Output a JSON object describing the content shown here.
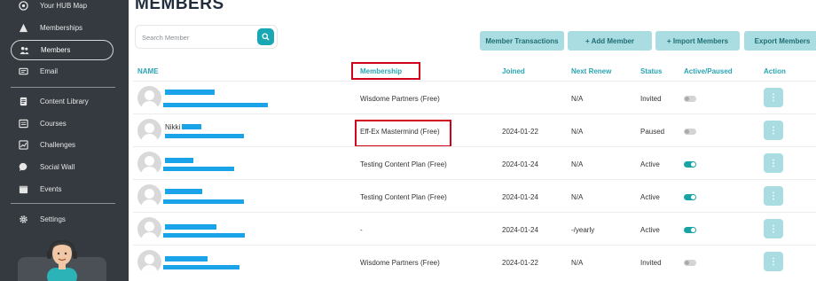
{
  "sidebar": {
    "items": [
      {
        "label": "Your HUB Map",
        "icon": "map-icon"
      },
      {
        "label": "Memberships",
        "icon": "memberships-icon"
      },
      {
        "label": "Members",
        "icon": "members-icon",
        "active": true
      },
      {
        "label": "Email",
        "icon": "email-icon"
      },
      {
        "label": "Content Library",
        "icon": "content-library-icon"
      },
      {
        "label": "Courses",
        "icon": "courses-icon"
      },
      {
        "label": "Challenges",
        "icon": "challenges-icon"
      },
      {
        "label": "Social Wall",
        "icon": "social-wall-icon"
      },
      {
        "label": "Events",
        "icon": "events-icon"
      },
      {
        "label": "Settings",
        "icon": "gear-icon"
      }
    ]
  },
  "header": {
    "title": "MEMBERS"
  },
  "search": {
    "placeholder": "Search Member",
    "icon": "search-icon"
  },
  "toolbar": {
    "member_transactions": "Member Transactions",
    "add_member": "+ Add Member",
    "import_members": "+ Import Members",
    "export_members": "Export Members"
  },
  "table": {
    "columns": {
      "name": "NAME",
      "membership": "Membership",
      "joined": "Joined",
      "next_renew": "Next Renew",
      "status": "Status",
      "active_paused": "Active/Paused",
      "action": "Action"
    },
    "rows": [
      {
        "name": "",
        "membership": "Wisdome Partners (Free)",
        "joined": "",
        "next_renew": "N/A",
        "status": "Invited",
        "active": false
      },
      {
        "name": "Nikki",
        "membership": "Eff-Ex Mastermind (Free)",
        "joined": "2024-01-22",
        "next_renew": "N/A",
        "status": "Paused",
        "active": false
      },
      {
        "name": "",
        "membership": "Testing Content Plan (Free)",
        "joined": "2024-01-24",
        "next_renew": "N/A",
        "status": "Active",
        "active": true
      },
      {
        "name": "",
        "membership": "Testing Content Plan (Free)",
        "joined": "2024-01-24",
        "next_renew": "N/A",
        "status": "Active",
        "active": true
      },
      {
        "name": "",
        "membership": "-",
        "joined": "2024-01-24",
        "next_renew": "-/yearly",
        "status": "Active",
        "active": true
      },
      {
        "name": "",
        "membership": "Wisdome Partners (Free)",
        "joined": "2024-01-22",
        "next_renew": "N/A",
        "status": "Invited",
        "active": false
      }
    ]
  },
  "colors": {
    "accent": "#19a7b3",
    "button_bg": "#a9dde1",
    "highlight": "#d0021b",
    "redaction": "#1aa3e8"
  }
}
